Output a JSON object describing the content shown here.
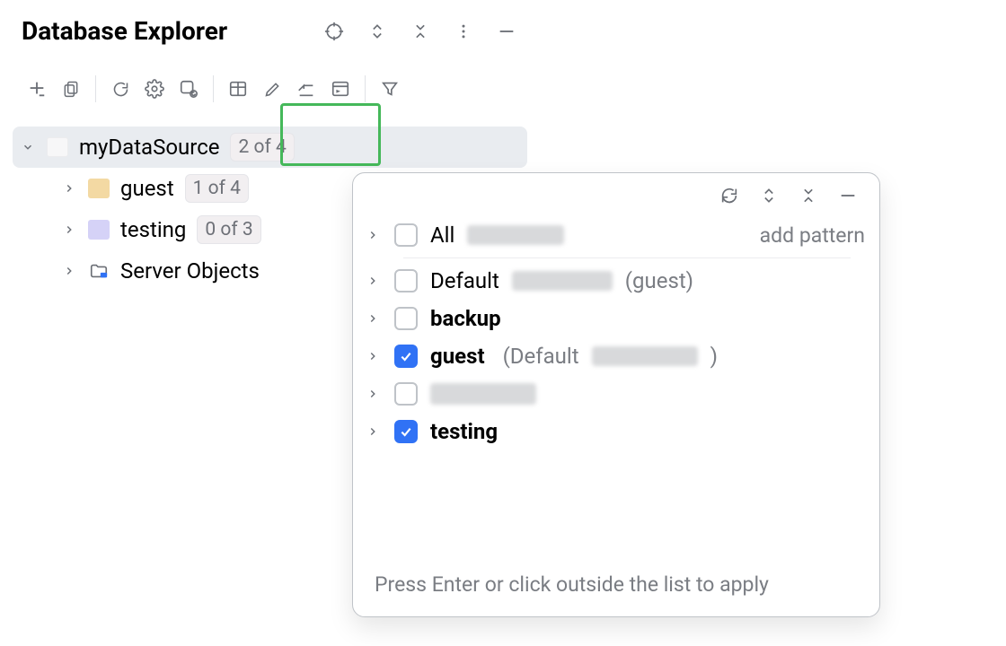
{
  "header": {
    "title": "Database Explorer"
  },
  "tree": {
    "dataSource": {
      "label": "myDataSource",
      "badge": "2 of 4"
    },
    "items": [
      {
        "label": "guest",
        "badge": "1 of 4"
      },
      {
        "label": "testing",
        "badge": "0 of 3"
      },
      {
        "label": "Server Objects"
      }
    ]
  },
  "popup": {
    "rows": [
      {
        "label": "All",
        "checked": false,
        "bold": false,
        "sub_default": "",
        "add_pattern": "add pattern",
        "has_blur": true,
        "blur_w": 120
      },
      {
        "label": "Default",
        "checked": false,
        "bold": false,
        "sub_default": "(guest)",
        "has_blur": true,
        "blur_w": 118
      },
      {
        "label": "backup",
        "checked": false,
        "bold": true
      },
      {
        "label": "guest",
        "checked": true,
        "bold": true,
        "sub_default_prefix": "(Default",
        "sub_default_suffix": ")",
        "has_blur": true,
        "blur_w": 122
      },
      {
        "label": "",
        "checked": false,
        "bold": true,
        "has_blur_label": true,
        "label_blur_w": 122
      },
      {
        "label": "testing",
        "checked": true,
        "bold": true
      }
    ],
    "footer": "Press Enter or click outside the list to apply"
  }
}
